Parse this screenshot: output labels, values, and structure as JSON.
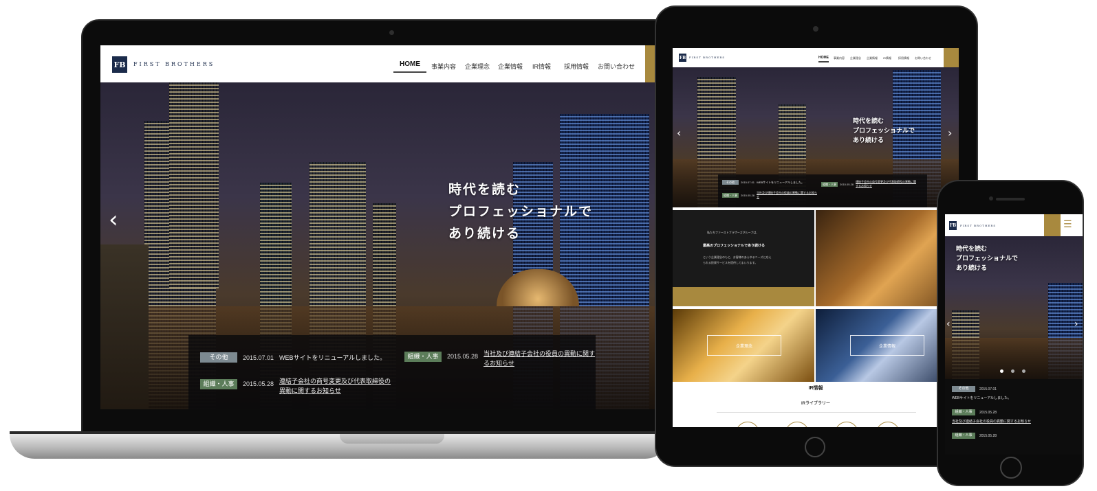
{
  "site": {
    "logo_mark": "FB",
    "logo_text": "FIRST BROTHERS",
    "nav": [
      "HOME",
      "事業内容",
      "企業理念",
      "企業情報",
      "IR情報",
      "採用情報",
      "お問い合わせ"
    ],
    "hero_lines": [
      "時代を読む",
      "プロフェッショナルで",
      "あり続ける"
    ],
    "prev_arrow": "‹",
    "next_arrow": "›",
    "news": [
      {
        "tag": "その他",
        "date": "2015.07.01",
        "text": "WEBサイトをリニューアルしました。"
      },
      {
        "tag": "組織・人事",
        "date": "2015.05.28",
        "text_line1": "当社及び連結子会社の役員の異動に関す",
        "text_line2": "るお知らせ"
      },
      {
        "tag": "組織・人事",
        "date": "2015.05.28",
        "text_line1": "連結子会社の商号変更及び代表取締役の",
        "text_line2": "異動に関するお知らせ"
      }
    ]
  },
  "tablet": {
    "intro_line1": "私たちファーストブラザーズグループは、",
    "intro_heading": "最高のプロフェッショナルであり続ける",
    "intro_line2": "という企業理念のもと、お客様のあらゆるニーズに応え",
    "intro_line3": "られる投資サービスを提供してまいります。",
    "btn_philosophy": "企業理念",
    "btn_company": "企業情報",
    "ir_title": "IR情報",
    "ir_library": "IRライブラリー",
    "news_short": [
      {
        "tag": "その他",
        "date": "2015.07.01",
        "text": "WEBサイトをリニューアルしました。"
      },
      {
        "tag": "組織・人事",
        "date": "2015.05.28",
        "text": "連結子会社の商号変更及び代表取締役の異動に関するお知らせ"
      },
      {
        "tag": "組織・人事",
        "date": "2015.05.28",
        "text": "当社及び連結子会社の役員の異動に関するお知らせ"
      }
    ]
  },
  "phone": {
    "menu_icon": "☰",
    "news": [
      {
        "tag": "その他",
        "date": "2015.07.01",
        "text": "WEBサイトをリニューアルしました。"
      },
      {
        "tag": "組織・人事",
        "date": "2015.05.28",
        "text": "当社及び連結子会社の役員の異動に関するお知らせ"
      },
      {
        "tag": "組織・人事",
        "date": "2015.05.28",
        "text": ""
      }
    ]
  },
  "colors": {
    "navy": "#1b2b4a",
    "gold": "#a8893e",
    "tag_green": "#5c7d5a",
    "tag_gray": "#7d8a91"
  }
}
